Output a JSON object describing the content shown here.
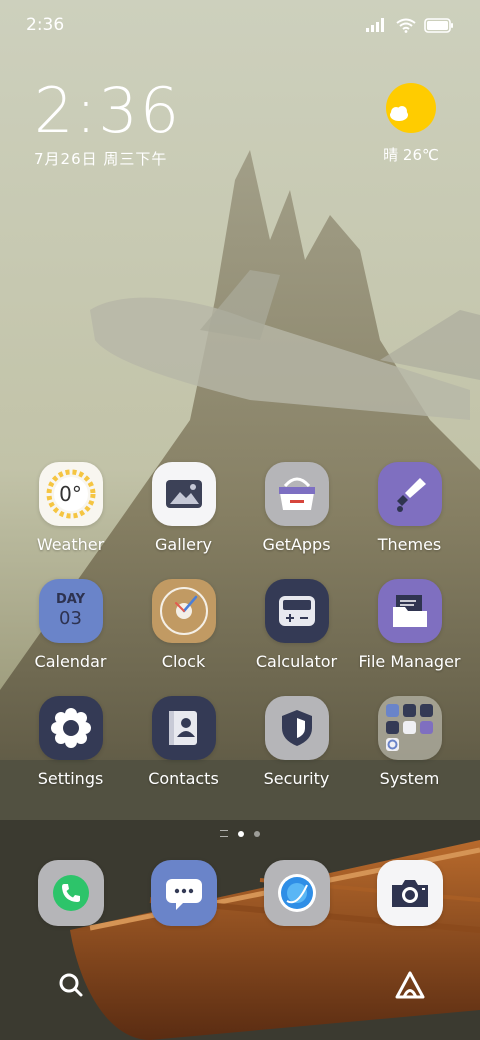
{
  "status_bar": {
    "time": "2:36"
  },
  "clock_widget": {
    "time": "2:36",
    "date": "7月26日 周三下午"
  },
  "weather_widget": {
    "label": "晴 26℃"
  },
  "apps": [
    {
      "label": "Weather",
      "icon": "weather-icon",
      "icon_text": "0°"
    },
    {
      "label": "Gallery",
      "icon": "gallery-icon"
    },
    {
      "label": "GetApps",
      "icon": "getapps-icon"
    },
    {
      "label": "Themes",
      "icon": "themes-icon"
    },
    {
      "label": "Calendar",
      "icon": "calendar-icon",
      "icon_top": "DAY",
      "icon_bottom": "03"
    },
    {
      "label": "Clock",
      "icon": "clock-icon"
    },
    {
      "label": "Calculator",
      "icon": "calculator-icon"
    },
    {
      "label": "File Manager",
      "icon": "file-manager-icon"
    },
    {
      "label": "Settings",
      "icon": "settings-icon"
    },
    {
      "label": "Contacts",
      "icon": "contacts-icon"
    },
    {
      "label": "Security",
      "icon": "security-icon"
    },
    {
      "label": "System",
      "icon": "system-folder-icon"
    }
  ],
  "dock": [
    {
      "icon": "phone-icon"
    },
    {
      "icon": "messages-icon"
    },
    {
      "icon": "browser-icon"
    },
    {
      "icon": "camera-icon"
    }
  ],
  "page_indicator": {
    "pages": 2,
    "active": 0
  },
  "colors": {
    "purple": "#7f6fc0",
    "navy": "#343a55",
    "blue": "#6a84c9",
    "gray": "#b9b9b9",
    "sun": "#ffcc00"
  }
}
